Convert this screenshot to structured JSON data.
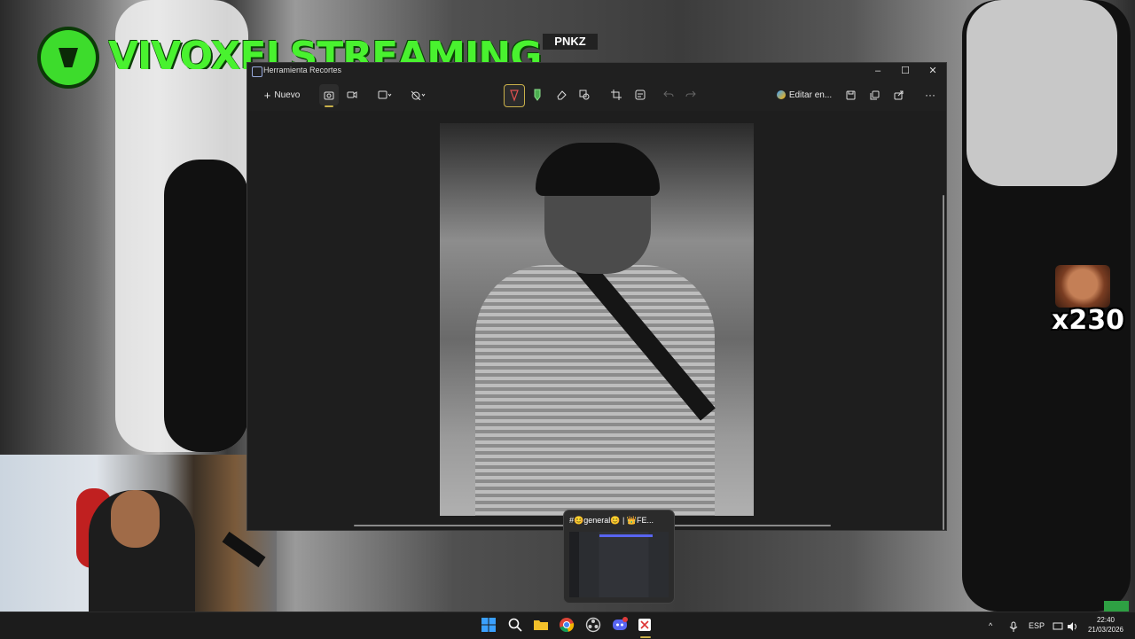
{
  "stream": {
    "brand": "VIVOXELSTREAMING",
    "tag": "PNKZ",
    "counter": "x230"
  },
  "window": {
    "title": "Herramienta Recortes",
    "controls": {
      "minimize": "–",
      "maximize": "☐",
      "close": "✕"
    }
  },
  "toolbar": {
    "new_label": "Nuevo",
    "edit_in_label": "Editar en...",
    "more": "···"
  },
  "preview": {
    "title": "#😊general😊 | 👑FE..."
  },
  "taskbar": {
    "language": "ESP",
    "time": "22:40",
    "date": "21/03/2026"
  },
  "colors": {
    "brand_green": "#49f22f",
    "accent_yellow": "#c9b04a",
    "discord": "#5865f2"
  }
}
